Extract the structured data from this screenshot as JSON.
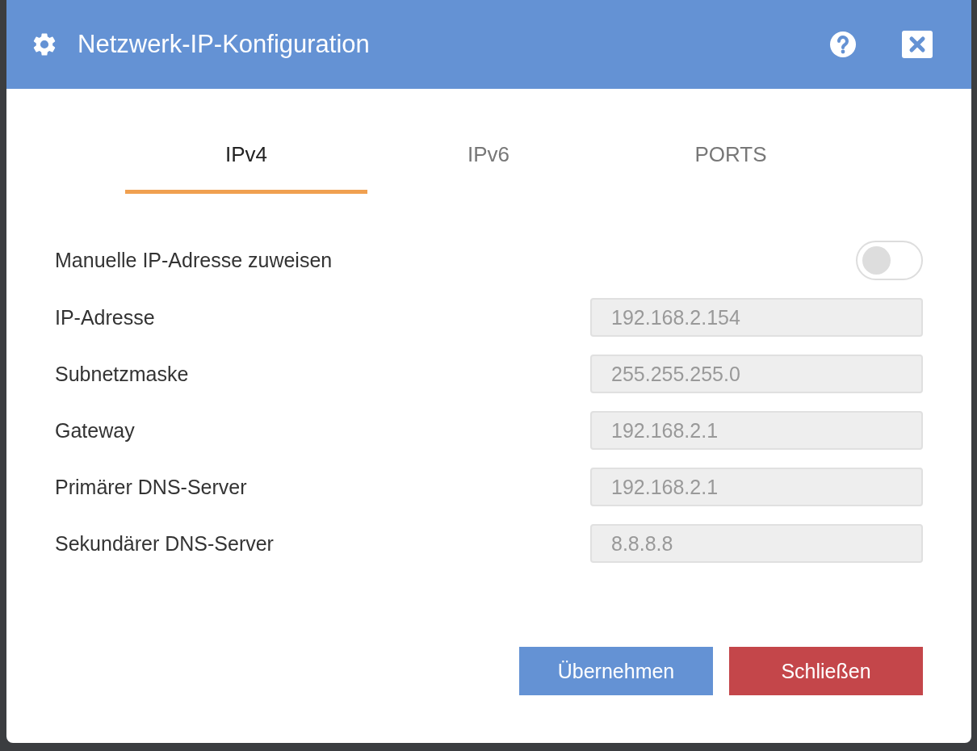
{
  "window": {
    "title": "Netzwerk-IP-Konfiguration"
  },
  "tabs": [
    {
      "label": "IPv4",
      "selected": true
    },
    {
      "label": "IPv6",
      "selected": false
    },
    {
      "label": "PORTS",
      "selected": false
    }
  ],
  "manual_ip": {
    "label": "Manuelle IP-Adresse zuweisen",
    "on": false
  },
  "fields": [
    {
      "label": "IP-Adresse",
      "value": "192.168.2.154",
      "disabled": true
    },
    {
      "label": "Subnetzmaske",
      "value": "255.255.255.0",
      "disabled": true
    },
    {
      "label": "Gateway",
      "value": "192.168.2.1",
      "disabled": true
    },
    {
      "label": "Primärer DNS-Server",
      "value": "192.168.2.1",
      "disabled": true
    },
    {
      "label": "Sekundärer DNS-Server",
      "value": "8.8.8.8",
      "disabled": true
    }
  ],
  "buttons": [
    {
      "label": "Übernehmen",
      "kind": "primary"
    },
    {
      "label": "Schließen",
      "kind": "danger"
    }
  ]
}
